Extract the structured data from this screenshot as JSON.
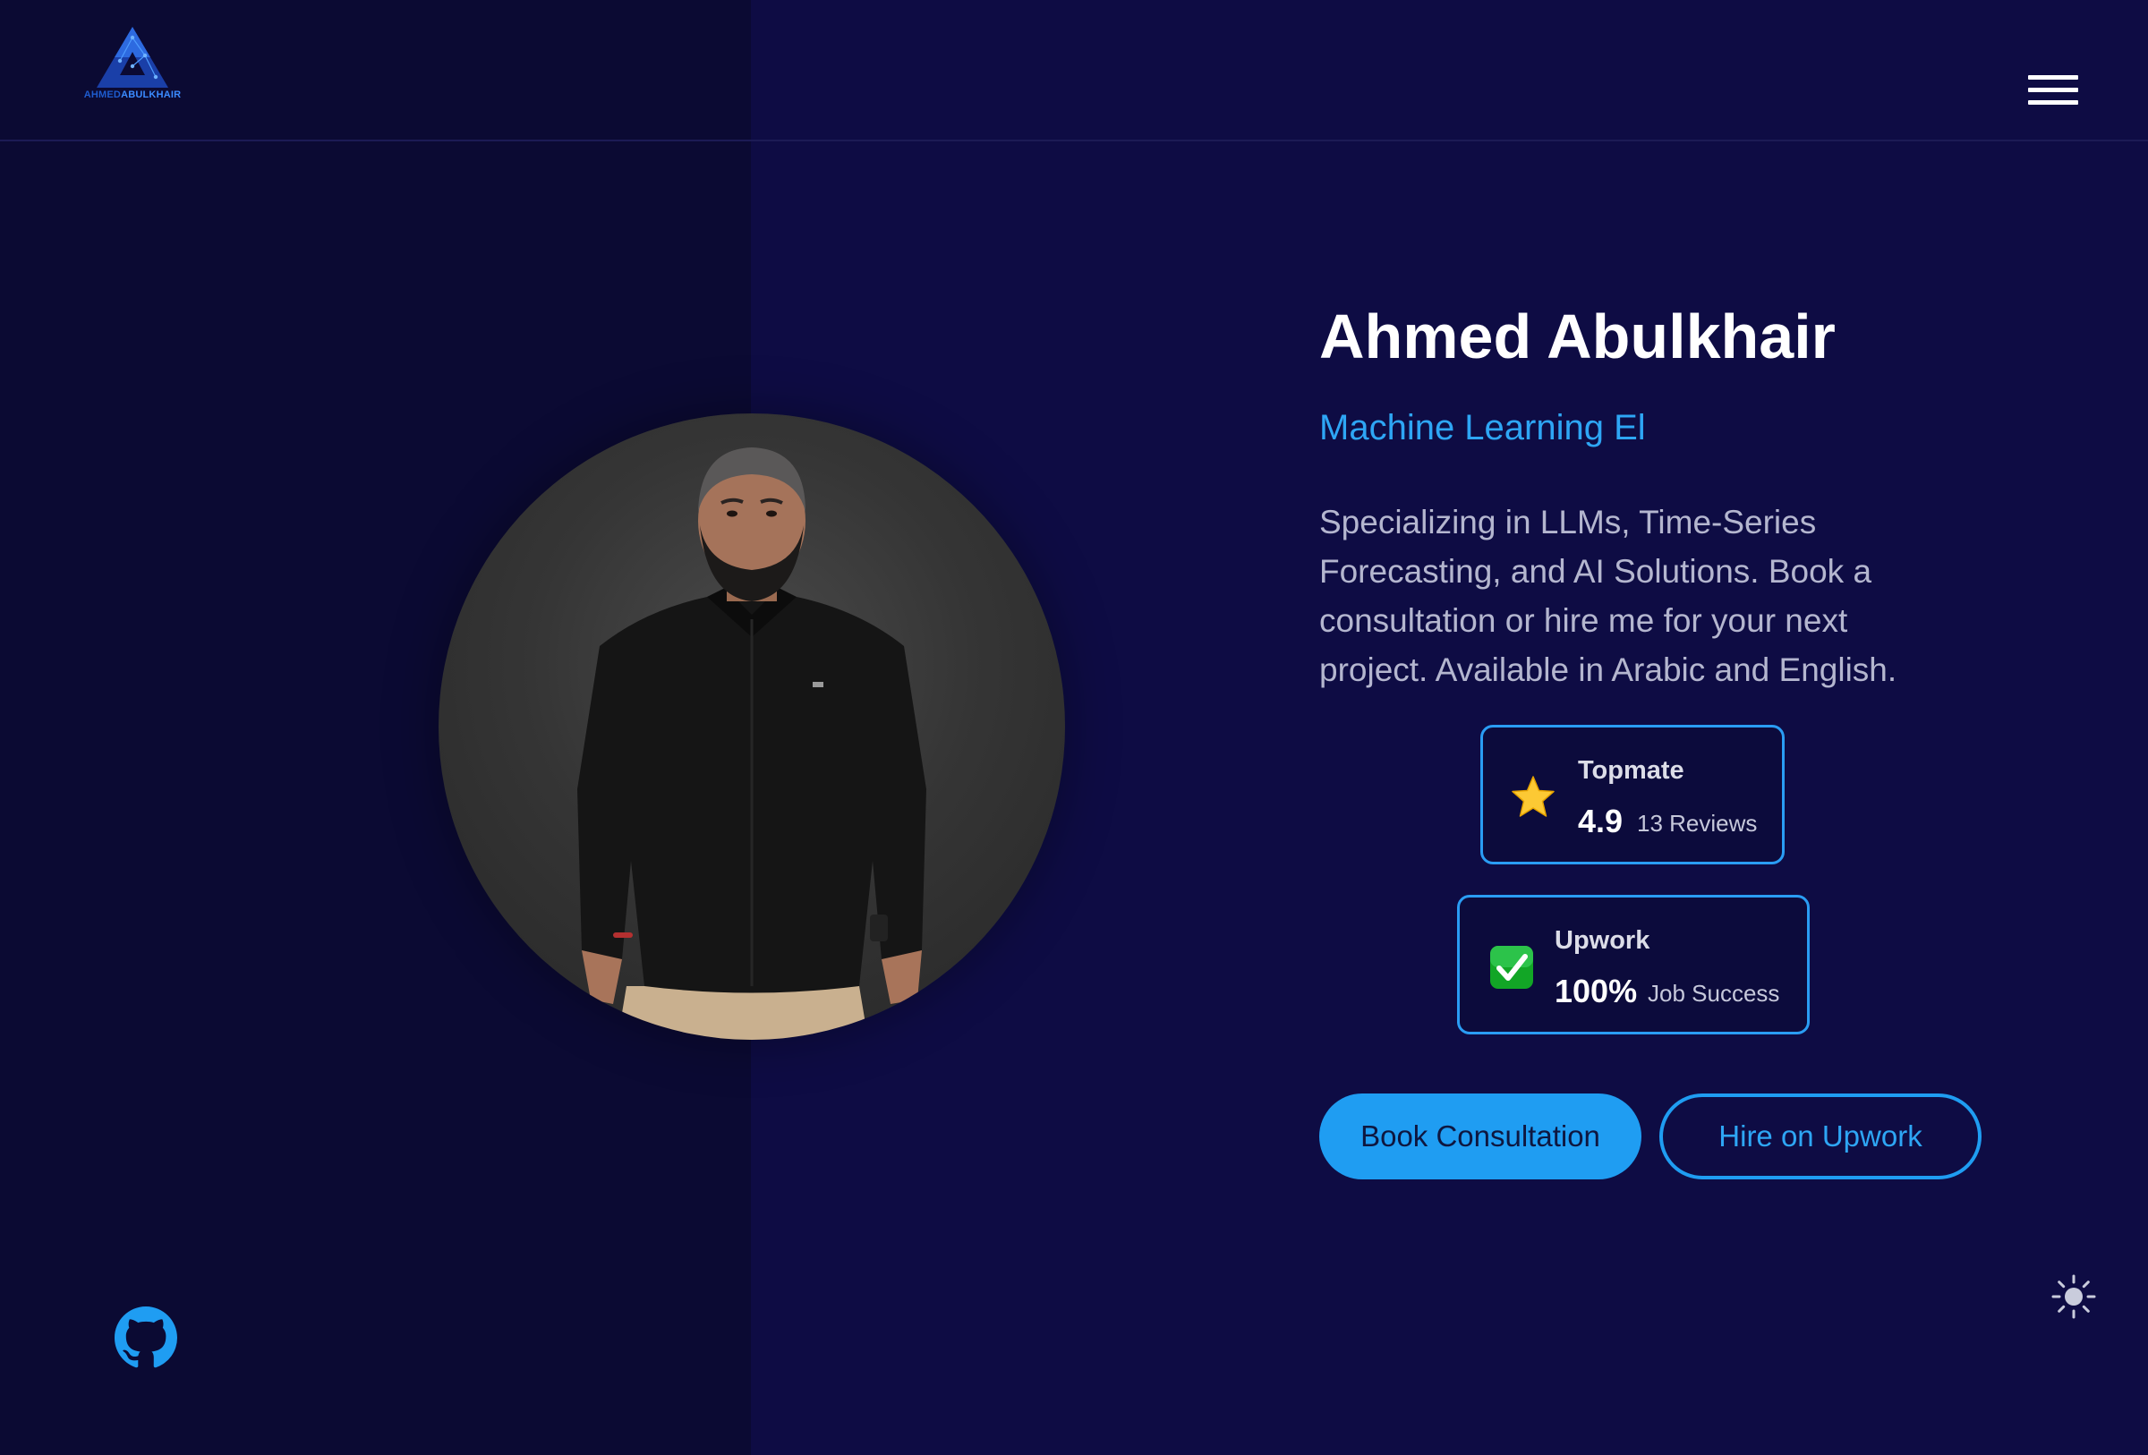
{
  "header": {
    "logo": {
      "icon": "triangle-network-logo",
      "text_first": "AHMED",
      "text_second": "ABULKHAIR"
    },
    "menu_icon": "hamburger-icon"
  },
  "hero": {
    "name": "Ahmed Abulkhair",
    "role": "Machine Learning El",
    "bio": "Specializing in LLMs, Time-Series Forecasting, and AI Solutions. Book a consultation or hire me for your next project. Available in Arabic and English.",
    "portrait_icon": "profile-photo"
  },
  "stats": [
    {
      "platform": "Topmate",
      "value": "4.9",
      "caption": "13 Reviews",
      "icon": "star-icon"
    },
    {
      "platform": "Upwork",
      "value": "100%",
      "caption": "Job Success",
      "icon": "check-mark-icon"
    }
  ],
  "actions": {
    "primary_label": "Book Consultation",
    "secondary_label": "Hire on Upwork"
  },
  "footer": {
    "github_icon": "github-icon",
    "theme_icon": "sun-icon"
  },
  "colors": {
    "background_left": "#0b0a33",
    "background_right": "#0e0c44",
    "accent": "#1f9df2",
    "heading": "#ffffff",
    "body_text": "#b4b6cf"
  }
}
